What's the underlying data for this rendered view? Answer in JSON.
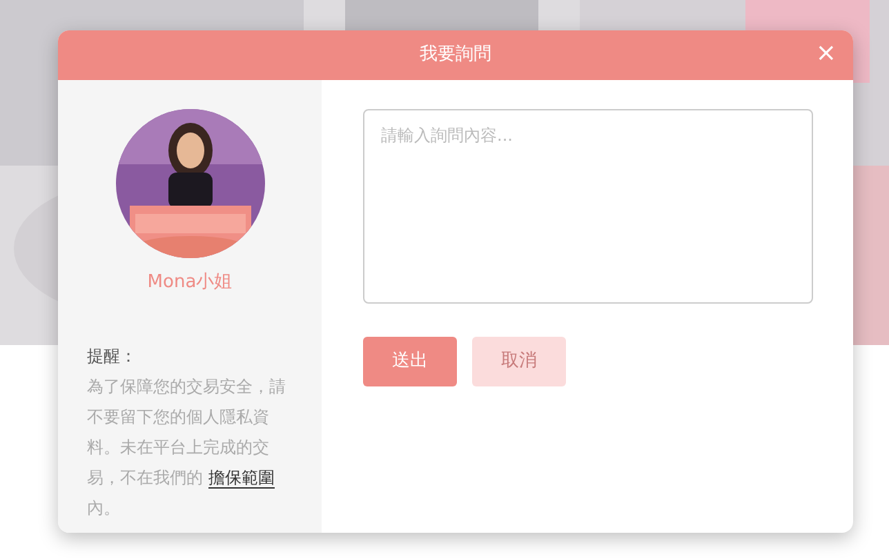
{
  "dialog": {
    "title": "我要詢問",
    "close": "×"
  },
  "profile": {
    "name": "Mona小姐"
  },
  "reminder": {
    "label": "提醒：",
    "text_before": "為了保障您的交易安全，請不要留下您的個人隱私資料。未在平台上完成的交易，不在我們的",
    "link": "擔保範圍",
    "text_after": "內。"
  },
  "message": {
    "placeholder": "請輸入詢問內容..."
  },
  "buttons": [
    {
      "label": "送出",
      "disabled": false
    },
    {
      "label": "取消",
      "disabled": true
    }
  ]
}
